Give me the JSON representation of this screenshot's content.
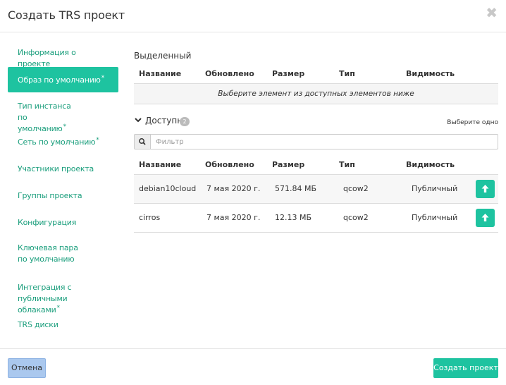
{
  "dialog": {
    "title": "Создать TRS проект",
    "close_glyph": "✖"
  },
  "sidebar": {
    "items": [
      {
        "label": "Информация о проекте",
        "required": false,
        "active": false
      },
      {
        "label": "Образ по умолчанию",
        "required": true,
        "active": true
      },
      {
        "label": "Тип инстанса по умолчанию",
        "required": true,
        "active": false
      },
      {
        "label": "Сеть по умолчанию",
        "required": true,
        "active": false
      },
      {
        "label": "Участники проекта",
        "required": false,
        "active": false
      },
      {
        "label": "Группы проекта",
        "required": false,
        "active": false
      },
      {
        "label": "Конфигурация",
        "required": false,
        "active": false
      },
      {
        "label": "Ключевая пара по умолчанию",
        "required": false,
        "active": false
      },
      {
        "label": "Интеграция с публичными облаками",
        "required": true,
        "active": false
      },
      {
        "label": "TRS диски",
        "required": false,
        "active": false
      }
    ],
    "required_mark": "*"
  },
  "selected": {
    "label": "Выделенный",
    "columns": [
      "Название",
      "Обновлено",
      "Размер",
      "Тип",
      "Видимость"
    ],
    "empty_text": "Выберите элемент из доступных элементов ниже"
  },
  "available": {
    "label": "Доступно",
    "count": "2",
    "hint": "Выберите одно",
    "filter_placeholder": "Фильтр",
    "columns": [
      "Название",
      "Обновлено",
      "Размер",
      "Тип",
      "Видимость"
    ],
    "rows": [
      {
        "name": "debian10cloud",
        "updated": "7 мая 2020 г.",
        "size": "571.84 МБ",
        "type": "qcow2",
        "visibility": "Публичный"
      },
      {
        "name": "cirros",
        "updated": "7 мая 2020 г.",
        "size": "12.13 МБ",
        "type": "qcow2",
        "visibility": "Публичный"
      }
    ]
  },
  "footer": {
    "cancel_label": "Отмена",
    "create_label": "Создать проект"
  },
  "colors": {
    "accent": "#1ec3a0",
    "link": "#1a9e7c",
    "cancel": "#aac8ee"
  }
}
